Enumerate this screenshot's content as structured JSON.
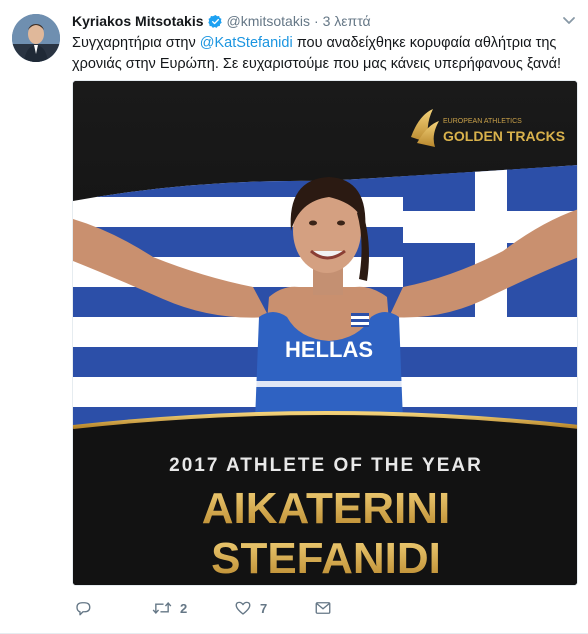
{
  "tweet": {
    "author_name": "Kyriakos Mitsotakis",
    "handle": "@kmitsotakis",
    "separator": "·",
    "time": "3 λεπτά",
    "text_before": "Συγχαρητήρια στην ",
    "mention": "@KatStefanidi",
    "text_after": " που αναδείχθηκε κορυφαία αθλήτρια της χρονιάς στην Ευρώπη. Σε ευχαριστούμε που μας κάνεις υπερήφανους ξανά!",
    "icons": {
      "avatar": "avatar",
      "verified": "verified-badge-icon",
      "caret": "chevron-down-icon",
      "reply": "reply-icon",
      "retweet": "retweet-icon",
      "like": "heart-icon",
      "dm": "envelope-icon"
    }
  },
  "media": {
    "logo_line1": "EUROPEAN ATHLETICS",
    "logo_line2": "GOLDEN TRACKS",
    "jersey_text": "HELLAS",
    "headline": "2017 ATHLETE OF THE YEAR",
    "first_name": "AIKATERINI",
    "last_name": "STEFANIDI"
  },
  "actions": {
    "reply_count": "",
    "retweet_count": "2",
    "like_count": "7"
  },
  "colors": {
    "text": "#14171a",
    "secondary": "#657786",
    "link": "#1b95e0",
    "verified": "#1da1f2",
    "gold": "#d9b24c",
    "greek_blue": "#2c4fa8"
  }
}
